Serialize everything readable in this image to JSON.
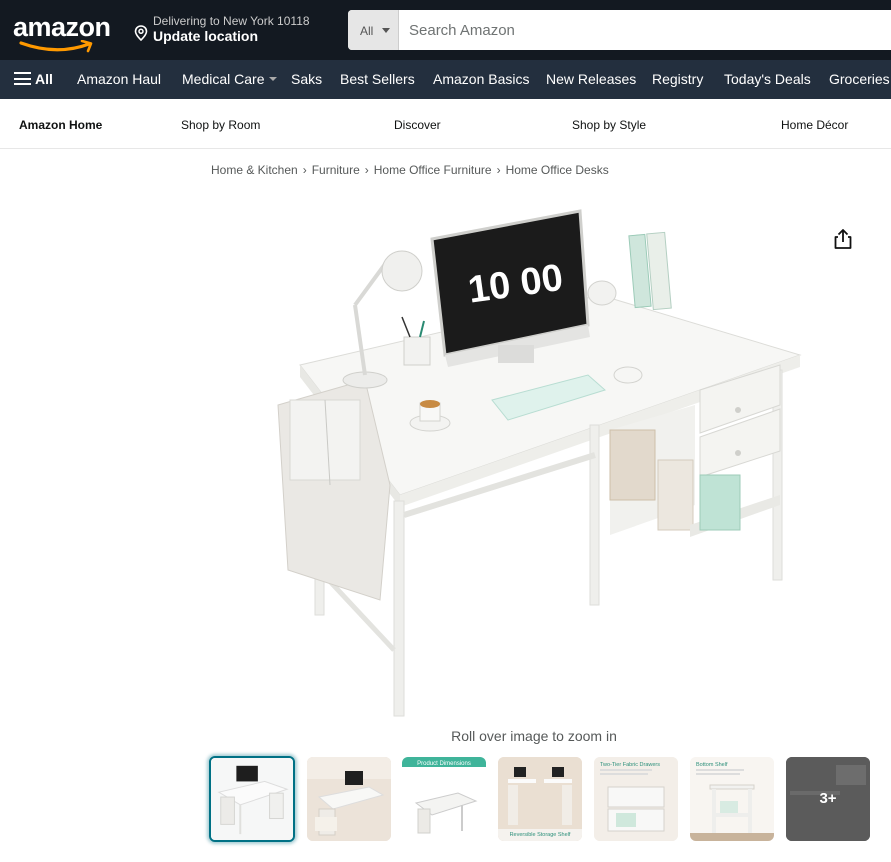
{
  "header": {
    "logo_text": "amazon",
    "deliver_line1": "Delivering to New York 10118",
    "deliver_line2": "Update location",
    "search_category": "All",
    "search_placeholder": "Search Amazon"
  },
  "nav": {
    "all_label": "All",
    "items": [
      "Amazon Haul",
      "Medical Care",
      "Saks",
      "Best Sellers",
      "Amazon Basics",
      "New Releases",
      "Registry",
      "Today's Deals",
      "Groceries"
    ]
  },
  "subnav": {
    "items": [
      "Amazon Home",
      "Shop by Room",
      "Discover",
      "Shop by Style",
      "Home Décor"
    ]
  },
  "breadcrumb": [
    "Home & Kitchen",
    "Furniture",
    "Home Office Furniture",
    "Home Office Desks"
  ],
  "product": {
    "monitor_clock": "10 00",
    "zoom_hint": "Roll over image to zoom in",
    "more_thumbs": "3+",
    "thumb2_caption": "Product Dimensions",
    "thumb4_caption": "Reversible Storage Shelf",
    "thumb5_caption": "Two-Tier Fabric Drawers",
    "thumb6_caption": "Bottom Shelf"
  },
  "colors": {
    "topbar": "#131921",
    "navbar": "#232f3e",
    "logo_smile": "#ff9900",
    "thumb_selected": "#007185"
  }
}
